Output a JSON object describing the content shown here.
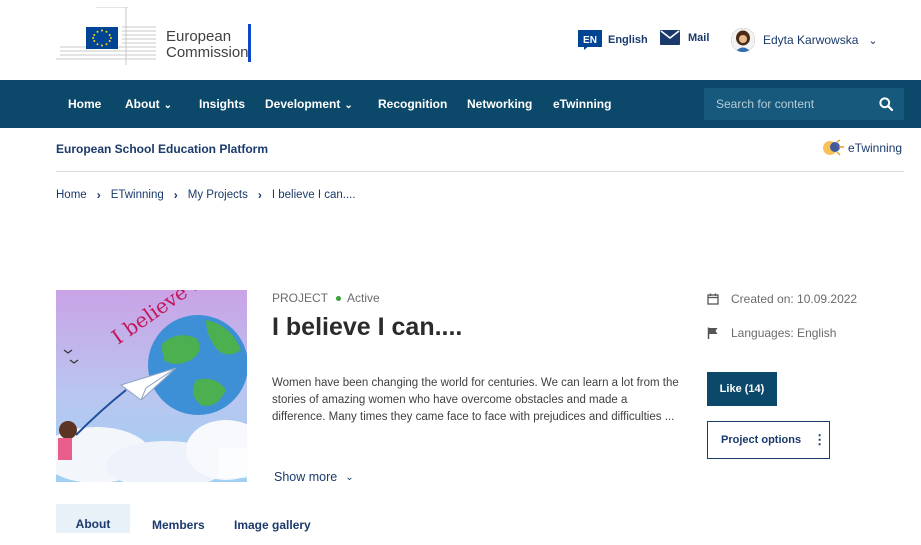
{
  "header": {
    "logo_text_line1": "European",
    "logo_text_line2": "Commission",
    "lang_code": "EN",
    "lang_label": "English",
    "mail_label": "Mail",
    "user_name": "Edyta Karwowska"
  },
  "nav": {
    "items": [
      "Home",
      "About",
      "Insights",
      "Development",
      "Recognition",
      "Networking",
      "eTwinning"
    ],
    "search_placeholder": "Search for content"
  },
  "platform": {
    "name": "European School Education Platform",
    "twin_label": "eTwinning"
  },
  "breadcrumb": [
    "Home",
    "ETwinning",
    "My Projects",
    "I believe I can...."
  ],
  "project": {
    "kicker": "PROJECT",
    "status": "Active",
    "title": "I believe I can....",
    "description": "Women have been changing the world for centuries. We can learn a lot from the stories of amazing women who have overcome obstacles and made a difference. Many times they came face to face with prejudices and difficulties ...",
    "show_more": "Show more",
    "created": "Created on: 10.09.2022",
    "languages": "Languages: English",
    "like_label": "Like (14)",
    "options_label": "Project options",
    "image_text": "I believe I can"
  },
  "tabs": [
    "About",
    "Members",
    "Image gallery"
  ],
  "colors": {
    "nav_bg": "#0b4869",
    "eu_blue": "#004494",
    "eu_yellow": "#ffd617",
    "accent_link": "#1a3a6b",
    "status_green": "#3aa13a"
  }
}
